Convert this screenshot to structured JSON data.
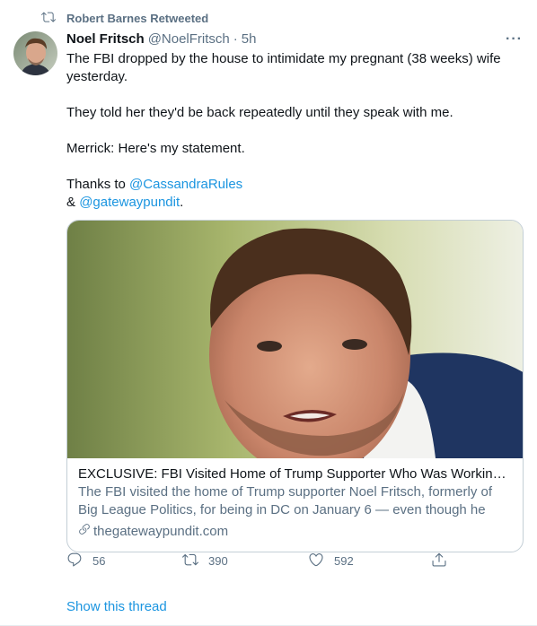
{
  "retweet_context": {
    "label": "Robert Barnes Retweeted",
    "icon": "retweet-icon"
  },
  "tweet": {
    "display_name": "Noel Fritsch",
    "handle": "@NoelFritsch",
    "separator": "·",
    "time": "5h",
    "more_label": "···",
    "paragraphs": {
      "p1": "The FBI dropped by the house to intimidate my pregnant (38 weeks) wife yesterday.",
      "p2": "They told her they'd be back repeatedly until they speak with me.",
      "p3": "Merrick: Here's my statement.",
      "p4_prefix": "Thanks to ",
      "p4_mention1": "@CassandraRules",
      "p4_line2_prefix": "& ",
      "p4_mention2": "@gatewaypundit",
      "p4_suffix": "."
    }
  },
  "card": {
    "title": "EXCLUSIVE: FBI Visited Home of Trump Supporter Who Was Working in ...",
    "description": "The FBI visited the home of Trump supporter Noel Fritsch, formerly of Big League Politics, for being in DC on January 6 — even though he was no ...",
    "domain": "thegatewaypundit.com",
    "domain_icon": "link-icon"
  },
  "actions": {
    "reply_count": "56",
    "retweet_count": "390",
    "like_count": "592",
    "icons": [
      "reply-icon",
      "retweet-icon",
      "like-icon",
      "share-icon"
    ]
  },
  "show_thread": "Show this thread",
  "colors": {
    "accent": "#1b95e0",
    "secondary_text": "#5b7083",
    "primary_text": "#0f1419",
    "border": "#c4cfd6"
  }
}
